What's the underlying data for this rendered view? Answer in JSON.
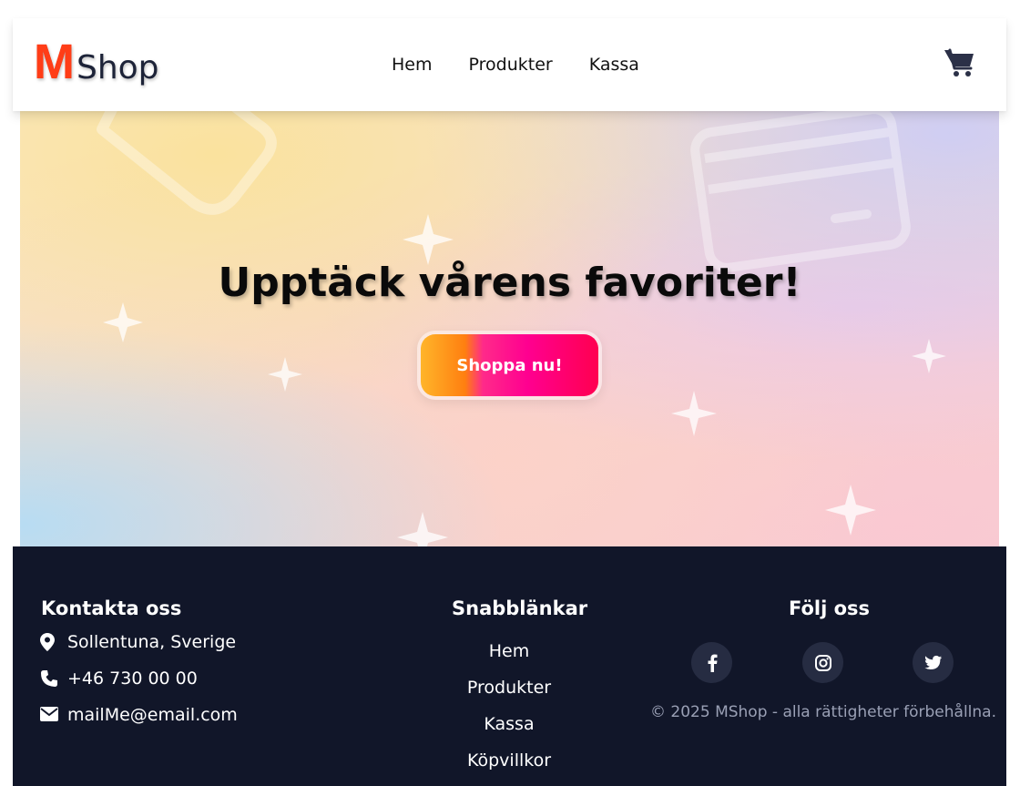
{
  "header": {
    "logo_m": "M",
    "logo_shop": "Shop",
    "nav": [
      "Hem",
      "Produkter",
      "Kassa"
    ],
    "cart_icon": "cart-icon"
  },
  "hero": {
    "title": "Upptäck vårens favoriter!",
    "cta": "Shoppa nu!"
  },
  "footer": {
    "contact": {
      "title": "Kontakta oss",
      "location": "Sollentuna, Sverige",
      "phone": "+46 730 00 00",
      "email": "mailMe@email.com"
    },
    "quick_links": {
      "title": "Snabblänkar",
      "items": [
        "Hem",
        "Produkter",
        "Kassa",
        "Köpvillkor"
      ]
    },
    "follow": {
      "title": "Följ oss",
      "icons": [
        "facebook-icon",
        "instagram-icon",
        "twitter-icon"
      ],
      "copyright": "© 2025 MShop - alla rättigheter förbehållna."
    }
  },
  "colors": {
    "footer_bg": "#111629",
    "logo_accent": "#ff3d17",
    "cta_gradient": [
      "#ffb52a",
      "#ff0090",
      "#ff0050"
    ]
  }
}
